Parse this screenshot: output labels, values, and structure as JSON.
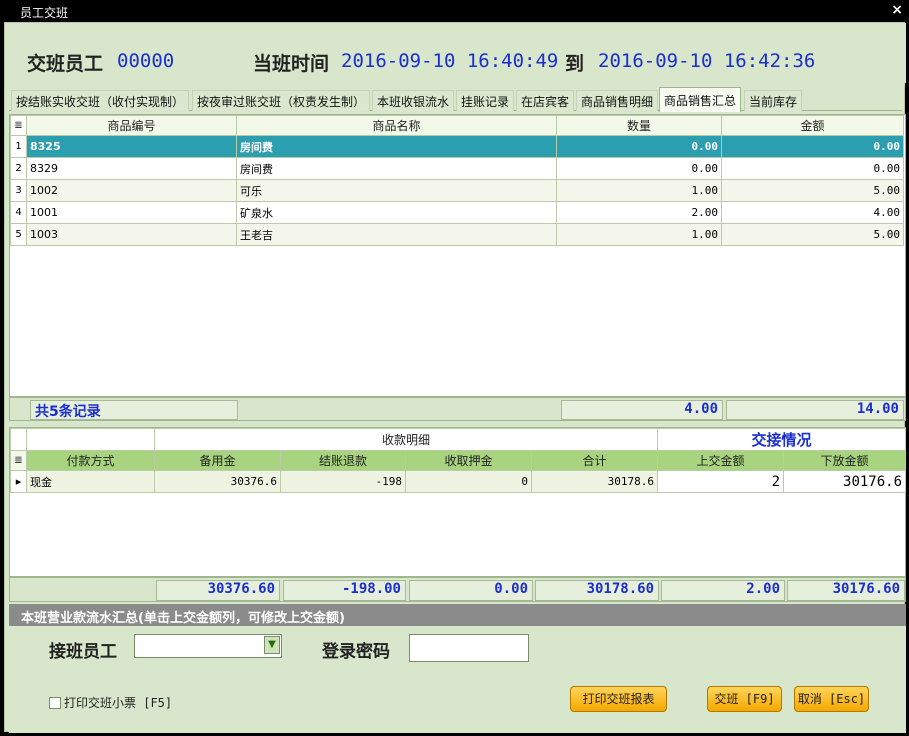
{
  "window": {
    "title": "员工交班",
    "close_glyph": "×"
  },
  "header": {
    "staff_label": "交班员工",
    "staff_id": "00000",
    "time_label": "当班时间",
    "start_time": "2016-09-10  16:40:49",
    "to_label": "到",
    "end_time": "2016-09-10  16:42:36"
  },
  "tabs": [
    {
      "label": "按结账实收交班（收付实现制）"
    },
    {
      "label": "按夜审过账交班（权责发生制）"
    },
    {
      "label": "本班收银流水"
    },
    {
      "label": "挂账记录"
    },
    {
      "label": "在店宾客"
    },
    {
      "label": "商品销售明细"
    },
    {
      "label": "商品销售汇总"
    },
    {
      "label": "当前库存"
    }
  ],
  "active_tab": "商品销售汇总",
  "goods_table": {
    "headers": {
      "code": "商品编号",
      "name": "商品名称",
      "qty": "数量",
      "amount": "金额"
    },
    "rows": [
      {
        "n": "1",
        "code": "8325",
        "name": "房间费",
        "qty": "0.00",
        "amount": "0.00"
      },
      {
        "n": "2",
        "code": "8329",
        "name": "房间费",
        "qty": "0.00",
        "amount": "0.00"
      },
      {
        "n": "3",
        "code": "1002",
        "name": "可乐",
        "qty": "1.00",
        "amount": "5.00"
      },
      {
        "n": "4",
        "code": "1001",
        "name": "矿泉水",
        "qty": "2.00",
        "amount": "4.00"
      },
      {
        "n": "5",
        "code": "1003",
        "name": "王老吉",
        "qty": "1.00",
        "amount": "5.00"
      }
    ],
    "footer": {
      "count": "共5条记录",
      "qty_total": "4.00",
      "amount_total": "14.00"
    }
  },
  "payment_table": {
    "group_label": "收款明细",
    "handover_label": "交接情况",
    "headers": {
      "method": "付款方式",
      "reserve": "备用金",
      "refund": "结账退款",
      "deposit": "收取押金",
      "total": "合计",
      "handed": "上交金额",
      "left": "下放金额"
    },
    "rows": [
      {
        "method": "现金",
        "reserve": "30376.6",
        "refund": "-198",
        "deposit": "0",
        "total": "30178.6",
        "handed": "2",
        "left": "30176.6"
      }
    ],
    "footer": {
      "reserve": "30376.60",
      "refund": "-198.00",
      "deposit": "0.00",
      "total": "30178.60",
      "handed": "2.00",
      "left": "30176.60"
    }
  },
  "summary_bar": "本班营业款流水汇总(单击上交金额列，可修改上交金额)",
  "form": {
    "receiver_label": "接班员工",
    "receiver_value": "",
    "password_label": "登录密码",
    "print_receipt_label": "打印交班小票 [F5]",
    "print_report_button": "打印交班报表",
    "handover_button": "交班 [F9]",
    "cancel_button": "取消 [Esc]"
  }
}
